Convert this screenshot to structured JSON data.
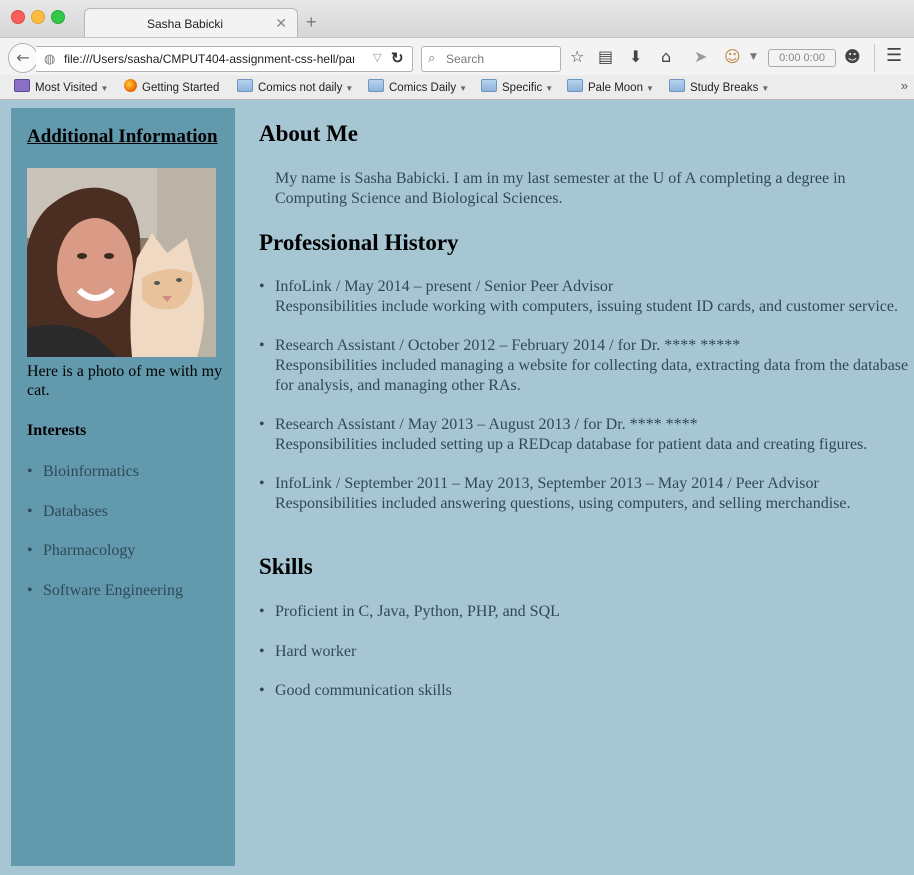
{
  "browser": {
    "tab_title": "Sasha Babicki",
    "url": "file:///Users/sasha/CMPUT404-assignment-css-hell/par",
    "search_placeholder": "Search",
    "timer": "0:00  0:00",
    "bookmarks": [
      {
        "label": "Most Visited",
        "icon": "most-visited-icon"
      },
      {
        "label": "Getting Started",
        "icon": "firefox-icon"
      },
      {
        "label": "Comics not daily",
        "icon": "folder-icon"
      },
      {
        "label": "Comics Daily",
        "icon": "folder-icon"
      },
      {
        "label": "Specific",
        "icon": "folder-icon"
      },
      {
        "label": "Pale Moon",
        "icon": "folder-icon"
      },
      {
        "label": "Study Breaks",
        "icon": "folder-icon"
      }
    ],
    "colors": {
      "page_bg": "#a6c6d4",
      "sidebar_bg": "#6299ad",
      "text": "#2d4a57"
    }
  },
  "sidebar": {
    "heading": "Additional Information",
    "caption": "Here is a photo of me with my cat.",
    "interests_title": "Interests",
    "interests": [
      "Bioinformatics",
      "Databases",
      "Pharmacology",
      "Software Engineering"
    ]
  },
  "main": {
    "about_heading": "About Me",
    "about_text": "My name is Sasha Babicki. I am in my last semester at the U of A completing a degree in Computing Science and Biological Sciences.",
    "history_heading": "Professional History",
    "jobs": [
      {
        "title": "InfoLink / May 2014 – present / Senior Peer Advisor",
        "desc": "Responsibilities include working with computers, issuing student ID cards, and customer service."
      },
      {
        "title": "Research Assistant / October 2012 – February 2014 / for Dr. **** *****",
        "desc": "Responsibilities included managing a website for collecting data, extracting data from the database for analysis, and managing other RAs."
      },
      {
        "title": "Research Assistant / May 2013 – August 2013 / for Dr. **** ****",
        "desc": "Responsibilities included setting up a REDcap database for patient data and creating figures."
      },
      {
        "title": "InfoLink / September 2011 – May 2013, September 2013 – May 2014 / Peer Advisor",
        "desc": "Responsibilities included answering questions, using computers, and selling merchandise."
      }
    ],
    "skills_heading": "Skills",
    "skills": [
      "Proficient in C, Java, Python, PHP, and SQL",
      "Hard worker",
      "Good communication skills"
    ]
  }
}
